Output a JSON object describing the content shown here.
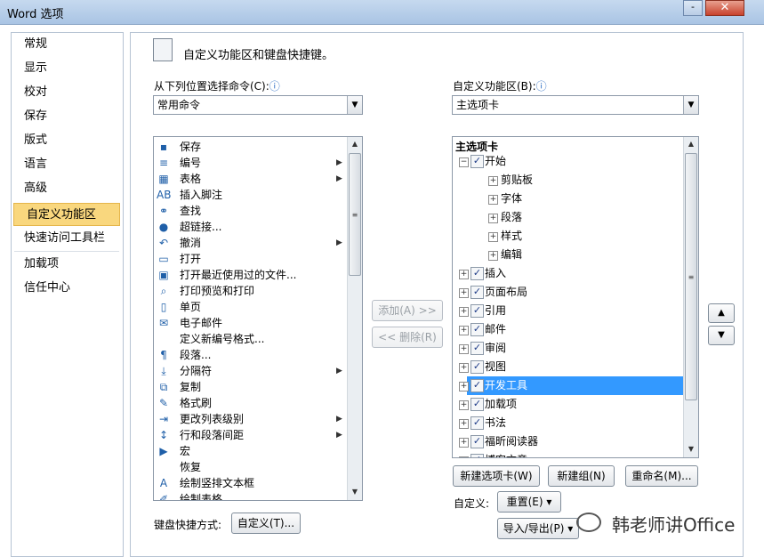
{
  "window": {
    "title": "Word 选项",
    "minimize_glyph": "-",
    "close_glyph": "✕"
  },
  "nav": {
    "items": [
      {
        "label": "常规"
      },
      {
        "label": "显示"
      },
      {
        "label": "校对"
      },
      {
        "label": "保存"
      },
      {
        "label": "版式"
      },
      {
        "label": "语言"
      },
      {
        "label": "高级"
      },
      {
        "label": "自定义功能区",
        "selected": true
      },
      {
        "label": "快速访问工具栏"
      },
      {
        "label": "加载项"
      },
      {
        "label": "信任中心"
      }
    ]
  },
  "header": {
    "text": "自定义功能区和键盘快捷键。",
    "icon": "customize-keyboard-icon"
  },
  "left": {
    "label": "从下列位置选择命令(C):",
    "info_glyph": "ⓘ",
    "combo_value": "常用命令",
    "commands": [
      {
        "label": "保存",
        "icon": "save-icon",
        "glyph": "▪"
      },
      {
        "label": "编号",
        "icon": "numbering-icon",
        "glyph": "≡",
        "sub": true
      },
      {
        "label": "表格",
        "icon": "table-icon",
        "glyph": "▦",
        "sub": true
      },
      {
        "label": "插入脚注",
        "icon": "footnote-icon",
        "glyph": "AB"
      },
      {
        "label": "查找",
        "icon": "find-icon",
        "glyph": "⚭"
      },
      {
        "label": "超链接...",
        "icon": "hyperlink-icon",
        "glyph": "●"
      },
      {
        "label": "撤消",
        "icon": "undo-icon",
        "glyph": "↶",
        "sub": true
      },
      {
        "label": "打开",
        "icon": "open-icon",
        "glyph": "▭"
      },
      {
        "label": "打开最近使用过的文件...",
        "icon": "recent-files-icon",
        "glyph": "▣"
      },
      {
        "label": "打印预览和打印",
        "icon": "print-preview-icon",
        "glyph": "⌕"
      },
      {
        "label": "单页",
        "icon": "single-page-icon",
        "glyph": "▯"
      },
      {
        "label": "电子邮件",
        "icon": "email-icon",
        "glyph": "✉"
      },
      {
        "label": "定义新编号格式...",
        "icon": "",
        "glyph": ""
      },
      {
        "label": "段落...",
        "icon": "paragraph-icon",
        "glyph": "¶"
      },
      {
        "label": "分隔符",
        "icon": "break-icon",
        "glyph": "⤓",
        "sub": true
      },
      {
        "label": "复制",
        "icon": "copy-icon",
        "glyph": "⧉"
      },
      {
        "label": "格式刷",
        "icon": "format-painter-icon",
        "glyph": "✎"
      },
      {
        "label": "更改列表级别",
        "icon": "list-level-icon",
        "glyph": "⇥",
        "sub": true
      },
      {
        "label": "行和段落间距",
        "icon": "line-spacing-icon",
        "glyph": "↕",
        "sub": true
      },
      {
        "label": "宏",
        "icon": "macro-icon",
        "glyph": "▶"
      },
      {
        "label": "恢复",
        "icon": "",
        "glyph": ""
      },
      {
        "label": "绘制竖排文本框",
        "icon": "vertical-textbox-icon",
        "glyph": "A"
      },
      {
        "label": "绘制表格",
        "icon": "draw-table-icon",
        "glyph": "✐"
      }
    ],
    "scroll_up": "▲",
    "scroll_down": "▼",
    "thumb_glyph": "≡"
  },
  "middle": {
    "add_label": "添加(A) >>",
    "remove_label": "<< 删除(R)"
  },
  "right": {
    "label": "自定义功能区(B):",
    "info_glyph": "ⓘ",
    "combo_value": "主选项卡",
    "tree_header": "主选项卡",
    "tree": [
      {
        "label": "开始",
        "level": 0,
        "expanded": true,
        "checked": true
      },
      {
        "label": "剪贴板",
        "level": 1
      },
      {
        "label": "字体",
        "level": 1
      },
      {
        "label": "段落",
        "level": 1
      },
      {
        "label": "样式",
        "level": 1
      },
      {
        "label": "编辑",
        "level": 1
      },
      {
        "label": "插入",
        "level": 0,
        "checked": true
      },
      {
        "label": "页面布局",
        "level": 0,
        "checked": true
      },
      {
        "label": "引用",
        "level": 0,
        "checked": true
      },
      {
        "label": "邮件",
        "level": 0,
        "checked": true
      },
      {
        "label": "审阅",
        "level": 0,
        "checked": true
      },
      {
        "label": "视图",
        "level": 0,
        "checked": true
      },
      {
        "label": "开发工具",
        "level": 0,
        "checked": true,
        "selected": true
      },
      {
        "label": "加载项",
        "level": 0,
        "checked": true
      },
      {
        "label": "书法",
        "level": 0,
        "checked": true
      },
      {
        "label": "福昕阅读器",
        "level": 0,
        "checked": true
      },
      {
        "label": "博客文章",
        "level": 0,
        "checked": true
      }
    ],
    "plus": "+",
    "minus": "−",
    "check": "✓",
    "new_tab_label": "新建选项卡(W)",
    "new_group_label": "新建组(N)",
    "rename_label": "重命名(M)...",
    "customize_label": "自定义:",
    "reset_label": "重置(E) ▾",
    "import_export_label": "导入/导出(P) ▾",
    "move_up": "▲",
    "move_down": "▼"
  },
  "keyboard": {
    "label": "键盘快捷方式:",
    "customize_label": "自定义(T)..."
  },
  "watermark": {
    "text": "韩老师讲Office"
  },
  "colors": {
    "selection": "#3399ff",
    "nav_selected": "#f9d77e"
  }
}
